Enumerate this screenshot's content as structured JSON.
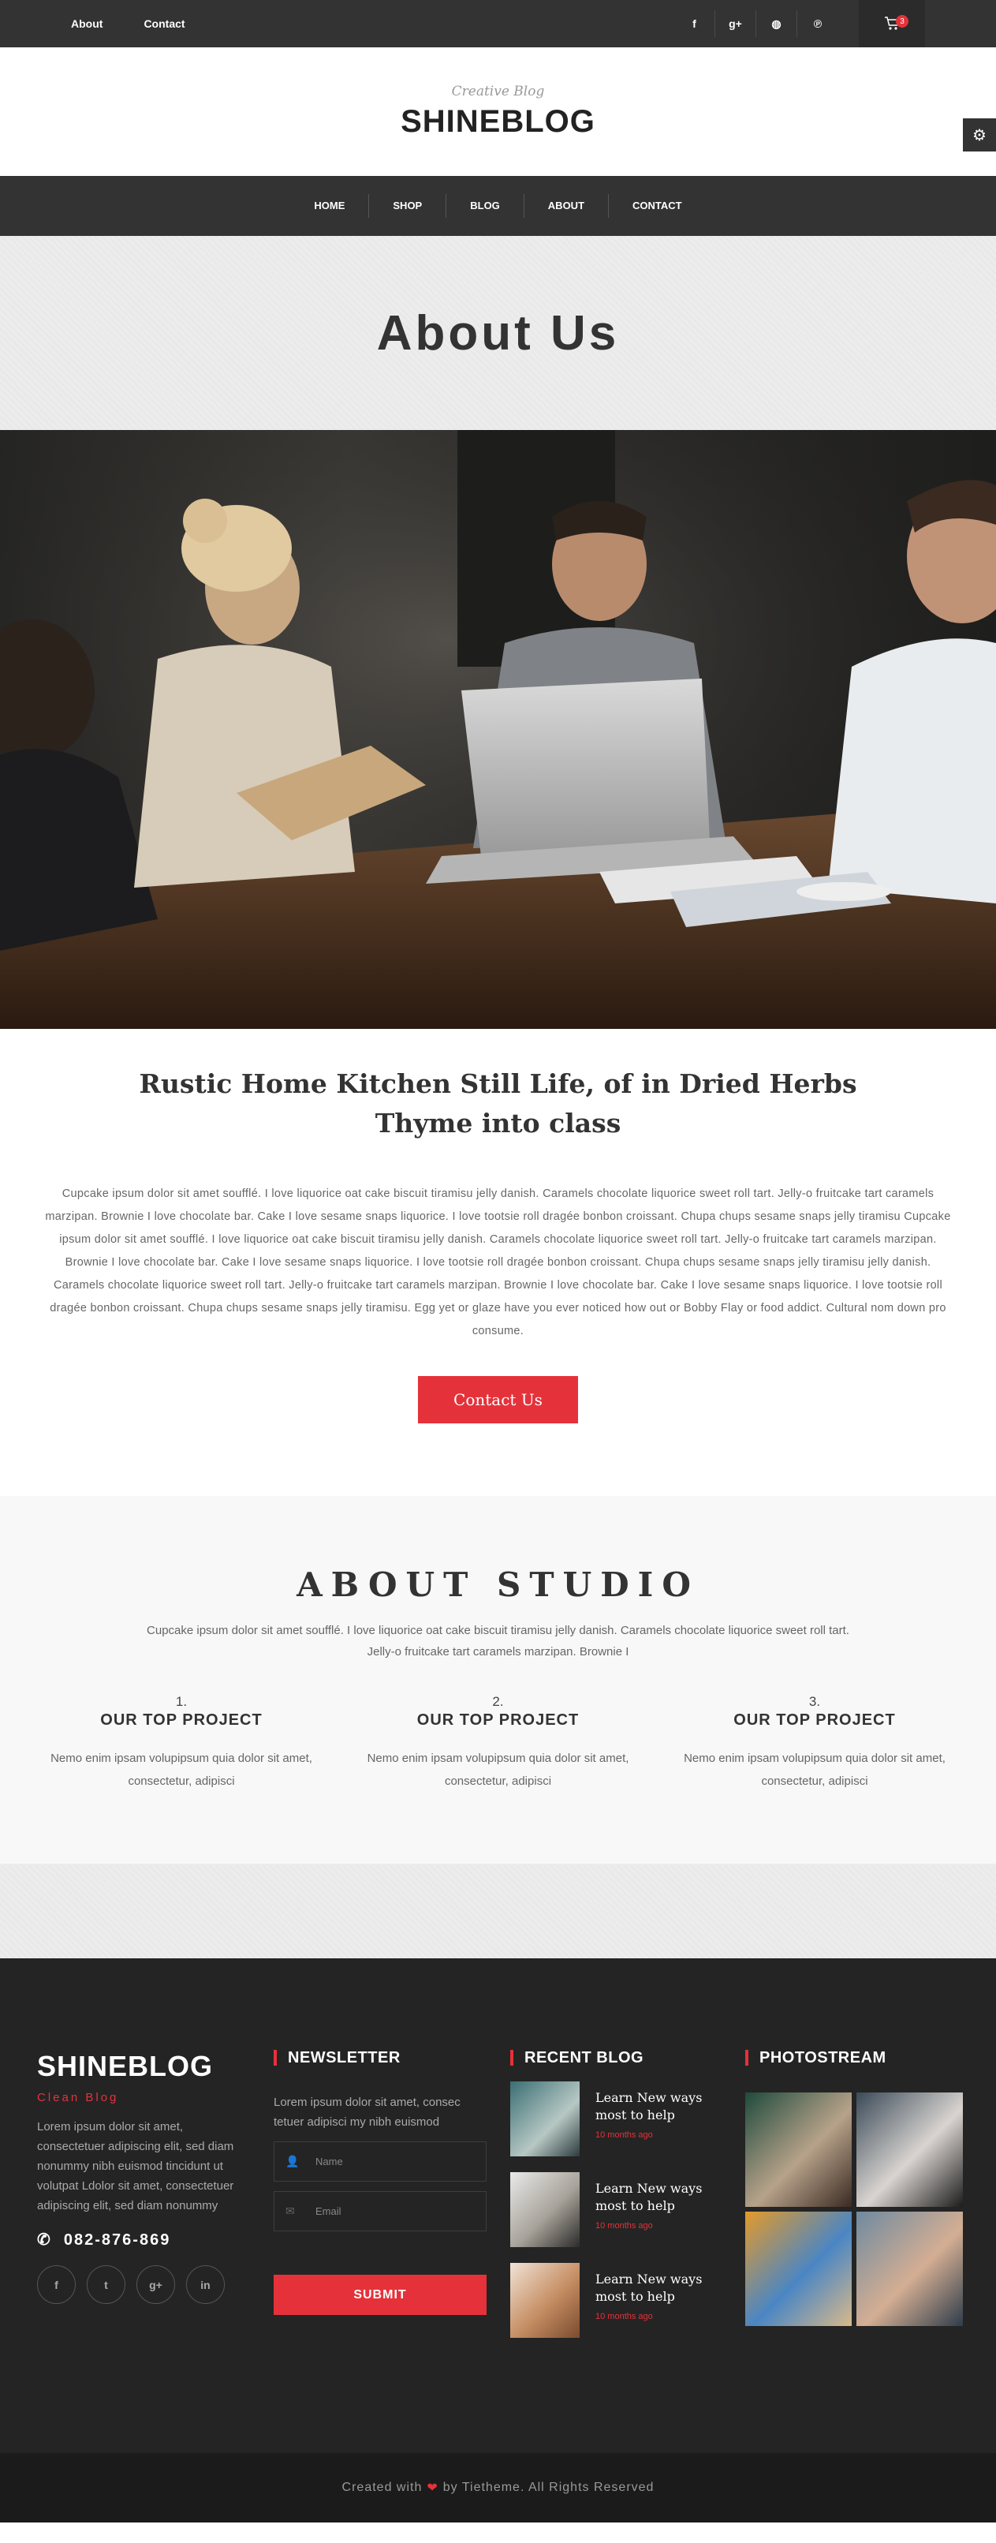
{
  "topbar": {
    "links": [
      "About",
      "Contact"
    ],
    "social": [
      "f",
      "g+",
      "◍",
      "℗"
    ],
    "cart_count": "3"
  },
  "brand": {
    "tagline": "Creative Blog",
    "name": "SHINEBLOG"
  },
  "nav": [
    "HOME",
    "SHOP",
    "BLOG",
    "ABOUT",
    "CONTACT"
  ],
  "page_title": "About Us",
  "article": {
    "title_line1": "Rustic Home Kitchen Still Life, of in Dried Herbs",
    "title_line2": "Thyme into class",
    "body": "Cupcake ipsum dolor sit amet soufflé. I love liquorice oat cake biscuit tiramisu jelly danish. Caramels chocolate liquorice sweet roll tart. Jelly-o fruitcake tart caramels marzipan. Brownie I love chocolate bar. Cake I love sesame snaps liquorice. I love tootsie roll dragée bonbon croissant. Chupa chups sesame snaps jelly tiramisu Cupcake ipsum dolor sit amet soufflé. I love liquorice oat cake biscuit tiramisu jelly danish. Caramels chocolate liquorice sweet roll tart. Jelly-o fruitcake tart caramels marzipan. Brownie I love chocolate bar. Cake I love sesame snaps liquorice. I love tootsie roll dragée bonbon croissant. Chupa chups sesame snaps jelly tiramisu jelly danish. Caramels chocolate liquorice sweet roll tart. Jelly-o fruitcake tart caramels marzipan. Brownie I love chocolate bar. Cake I love sesame snaps liquorice. I love tootsie roll dragée bonbon croissant. Chupa chups sesame snaps jelly tiramisu. Egg yet or glaze have you ever noticed how out or Bobby Flay or food addict. Cultural nom down pro consume.",
    "button": "Contact Us"
  },
  "studio": {
    "title": "ABOUT STUDIO",
    "intro": "Cupcake ipsum dolor sit amet soufflé. I love liquorice oat cake biscuit tiramisu jelly danish. Caramels chocolate liquorice sweet roll tart. Jelly-o fruitcake tart caramels marzipan. Brownie I",
    "items": [
      {
        "num": "1.",
        "title": "OUR TOP PROJECT",
        "text": "Nemo enim ipsam volupipsum quia dolor sit amet, consectetur, adipisci"
      },
      {
        "num": "2.",
        "title": "OUR TOP PROJECT",
        "text": "Nemo enim ipsam volupipsum quia dolor sit amet, consectetur, adipisci"
      },
      {
        "num": "3.",
        "title": "OUR TOP PROJECT",
        "text": "Nemo enim ipsam volupipsum quia dolor sit amet, consectetur, adipisci"
      }
    ]
  },
  "footer": {
    "logo": "SHINEBLOG",
    "sub": "Clean Blog",
    "about": "Lorem ipsum dolor sit amet, consectetuer adipiscing elit, sed diam nonummy nibh euismod tincidunt ut volutpat Ldolor sit amet, consectetuer adipiscing elit, sed diam nonummy",
    "phone": "082-876-869",
    "social": [
      "f",
      "t",
      "g+",
      "in"
    ],
    "newsletter": {
      "title": "NEWSLETTER",
      "text": "Lorem ipsum dolor sit amet, consec tetuer adipisci my nibh euismod",
      "name_placeholder": "Name",
      "email_placeholder": "Email",
      "submit": "SUBMIT"
    },
    "recent": {
      "title": "RECENT BLOG",
      "items": [
        {
          "title": "Learn New ways most to help",
          "date": "10 months ago"
        },
        {
          "title": "Learn New ways most to help",
          "date": "10 months ago"
        },
        {
          "title": "Learn New ways most to help",
          "date": "10 months ago"
        }
      ]
    },
    "photostream": {
      "title": "PHOTOSTREAM"
    },
    "copyright_before": "Created with",
    "copyright_after": "by Tietheme. All Rights Reserved"
  },
  "colors": {
    "accent": "#e5323a",
    "dark": "#333333",
    "footer": "#242424"
  }
}
